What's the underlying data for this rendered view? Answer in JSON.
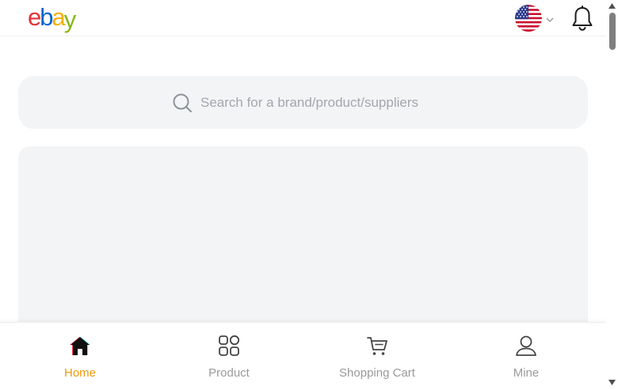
{
  "header": {
    "logo": {
      "e": "e",
      "b": "b",
      "a": "a",
      "y": "y"
    },
    "logo_colors": {
      "e": "#e53238",
      "b": "#0064d2",
      "a": "#f5af02",
      "y": "#86b817"
    },
    "region_icon": "us-flag-icon",
    "notifications_icon": "bell-icon"
  },
  "search": {
    "placeholder": "Search for a brand/product/suppliers",
    "icon": "search-icon"
  },
  "bottom_nav": {
    "active": "home",
    "active_color": "#ee9a0b",
    "items": [
      {
        "id": "home",
        "label": "Home",
        "icon": "home-icon"
      },
      {
        "id": "product",
        "label": "Product",
        "icon": "grid-icon"
      },
      {
        "id": "cart",
        "label": "Shopping Cart",
        "icon": "cart-icon"
      },
      {
        "id": "mine",
        "label": "Mine",
        "icon": "user-icon"
      }
    ]
  }
}
